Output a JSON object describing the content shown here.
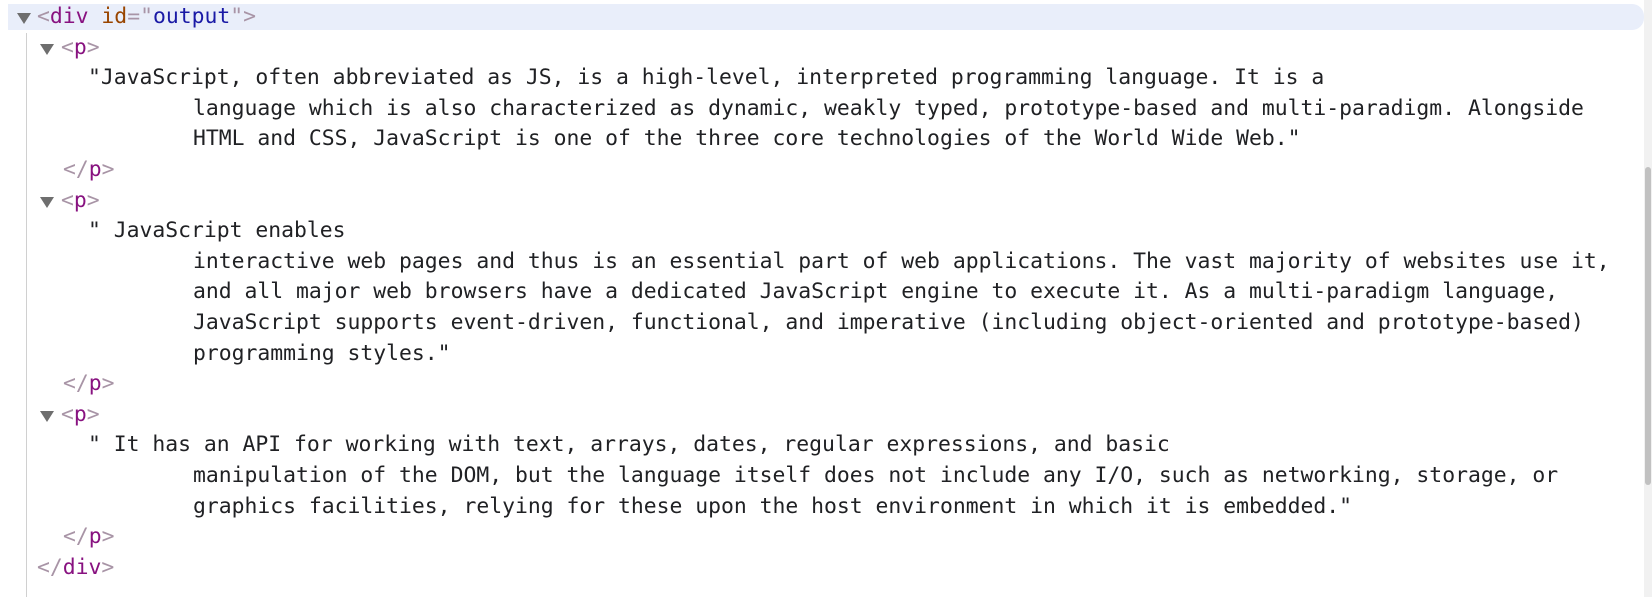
{
  "root": {
    "tag": "div",
    "attr_name": "id",
    "attr_value": "output"
  },
  "paragraphs": [
    {
      "tag": "p",
      "lines": [
        "\"JavaScript, often abbreviated as JS, is a high-level, interpreted programming language. It is a",
        "language which is also characterized as dynamic, weakly typed, prototype-based and multi-paradigm. Alongside",
        "HTML and CSS, JavaScript is one of the three core technologies of the World Wide Web.\""
      ]
    },
    {
      "tag": "p",
      "lines": [
        "\" JavaScript enables",
        "interactive web pages and thus is an essential part of web applications. The vast majority of websites use it,",
        "and all major web browsers have a dedicated JavaScript engine to execute it. As a multi-paradigm language,",
        "JavaScript supports event-driven, functional, and imperative (including object-oriented and prototype-based)",
        "programming styles.\""
      ]
    },
    {
      "tag": "p",
      "lines": [
        "\" It has an API for working with text, arrays, dates, regular expressions, and basic",
        "manipulation of the DOM, but the language itself does not include any I/O, such as networking, storage, or",
        "graphics facilities, relying for these upon the host environment in which it is embedded.\""
      ]
    }
  ]
}
